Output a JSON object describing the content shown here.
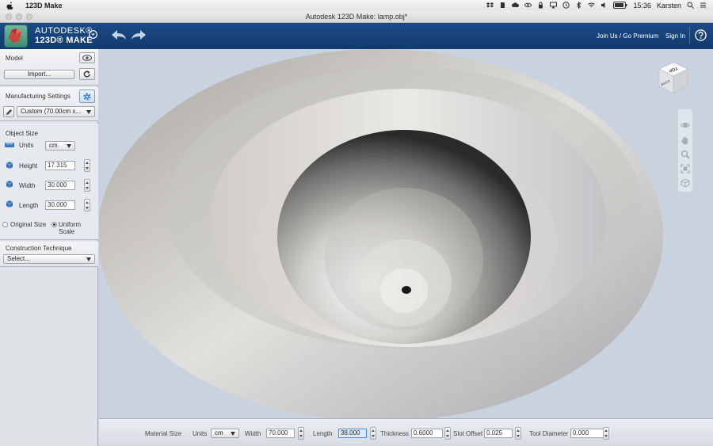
{
  "menubar": {
    "app_name": "123D Make",
    "clock": "15:36",
    "user": "Karsten"
  },
  "window": {
    "title": "Autodesk 123D Make: lamp.obj*"
  },
  "header": {
    "brand_line1": "AUTODESK®",
    "brand_line2": "123D® MAKE",
    "join_label": "Join Us / Go Premium",
    "signin_label": "Sign In"
  },
  "sidebar": {
    "model_label": "Model",
    "import_label": "Import...",
    "manufacturing_label": "Manufacturing Settings",
    "manufacturing_value": "Custom (70.00cm x...",
    "object_size_label": "Object Size",
    "units_label": "Units",
    "units_value": "cm",
    "height_label": "Height",
    "height_value": "17.315",
    "width_label": "Width",
    "width_value": "30.000",
    "length_label": "Length",
    "length_value": "30.000",
    "original_size_label": "Original Size",
    "uniform_scale_label": "Uniform Scale",
    "construction_label": "Construction Technique",
    "construction_value": "Select..."
  },
  "viewcube": {
    "top_label": "TOP",
    "back_label": "BACK"
  },
  "bottombar": {
    "material_size_label": "Material Size",
    "units_label": "Units",
    "units_value": "cm",
    "width_label": "Width",
    "width_value": "70.000",
    "length_label": "Length",
    "length_value": "38.000",
    "thickness_label": "Thickness",
    "thickness_value": "0.6000",
    "slot_offset_label": "Slot Offset",
    "slot_offset_value": "0.025",
    "tool_diameter_label": "Tool Diameter",
    "tool_diameter_value": "0.000"
  },
  "colors": {
    "header_blue": "#133f75",
    "sidebar_bg": "#dfe3e8",
    "viewport_bg": "#c9d2df",
    "gear_button": "#2f7fd8"
  }
}
